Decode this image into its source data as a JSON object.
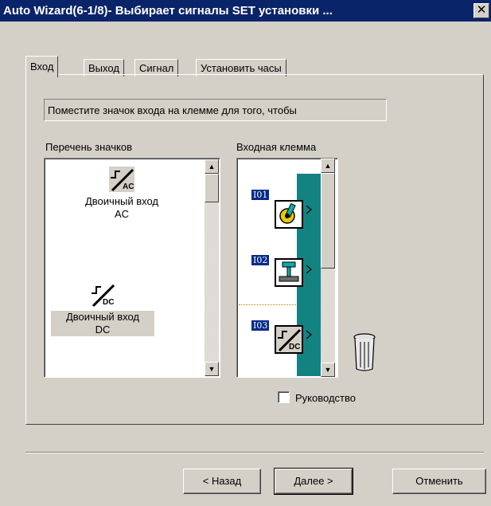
{
  "window": {
    "title": "Auto Wizard(6-1/8)- Выбирает сигналы SET установки ...",
    "close_label": "✕"
  },
  "tabs": [
    {
      "label": "Вход",
      "active": true
    },
    {
      "label": "Выход",
      "active": false
    },
    {
      "label": "Сигнал",
      "active": false
    },
    {
      "label": "Установить часы",
      "active": false
    }
  ],
  "instruction": "Поместите значок входа на клемме для того, чтобы",
  "icon_list": {
    "label": "Перечень значков",
    "items": [
      {
        "icon": "binary-input-ac-icon",
        "badge": "AC",
        "caption_line1": "Двоичный вход",
        "caption_line2": "AC",
        "selected": false
      },
      {
        "icon": "binary-input-dc-icon",
        "badge": "DC",
        "caption_line1": "Двоичный вход",
        "caption_line2": "DC",
        "selected": true
      }
    ]
  },
  "terminal_list": {
    "label": "Входная клемма",
    "rows": [
      {
        "io": "I01",
        "icon": "key-switch-icon"
      },
      {
        "io": "I02",
        "icon": "push-button-icon"
      },
      {
        "io": "I03",
        "icon": "binary-input-dc-icon",
        "badge": "DC"
      }
    ]
  },
  "manual_checkbox": {
    "label": "Руководство",
    "checked": false
  },
  "buttons": {
    "back": "< Назад",
    "next": "Далее >",
    "cancel": "Отменить"
  },
  "colors": {
    "titlebar": "#0a246a",
    "terminal_strip": "#138382",
    "io_label": "#002b88",
    "face": "#d4d0c8"
  }
}
